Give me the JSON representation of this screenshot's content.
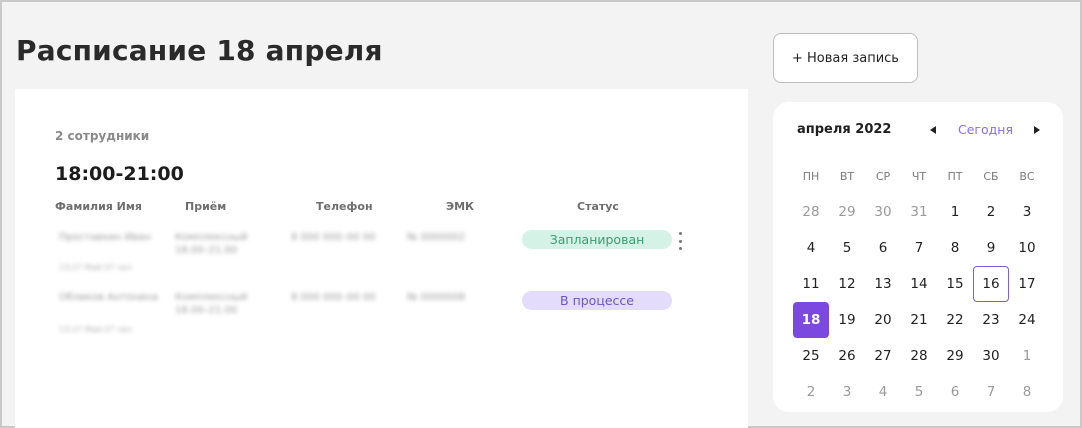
{
  "header": {
    "title": "Расписание 18 апреля",
    "new_button_label": "+ Новая запись"
  },
  "schedule": {
    "employees_count": "2 сотрудники",
    "time_range": "18:00-21:00",
    "columns": [
      "Фамилия Имя",
      "Приём",
      "Телефон",
      "ЭМК",
      "Статус"
    ],
    "rows": [
      {
        "name": "Проставкин Иван",
        "time": "13:27 Май 07 чел",
        "service": "Комплексный 18.00–21.00",
        "phone": "8 000 000–00 00",
        "emk": "№ 0000002",
        "status": "Запланирован",
        "status_bg": "#d4f3e6",
        "status_color": "#3d9b72"
      },
      {
        "name": "Обликов Антонина",
        "time": "13:27 Май 07 чел",
        "service": "Комплексный 18.00–21.00",
        "phone": "8 000 000–00 00",
        "emk": "№ 0000008",
        "status": "В процессе",
        "status_bg": "#e3dcfa",
        "status_color": "#6d55c4"
      }
    ]
  },
  "calendar": {
    "month_label": "апреля 2022",
    "today_label": "Сегодня",
    "weekdays": [
      "ПН",
      "ВТ",
      "СР",
      "ЧТ",
      "ПТ",
      "СБ",
      "ВС"
    ],
    "selected_day": 18,
    "today_day": 16,
    "accent_color": "#7b48e0",
    "weeks": [
      [
        {
          "d": "28",
          "o": true
        },
        {
          "d": "29",
          "o": true
        },
        {
          "d": "30",
          "o": true
        },
        {
          "d": "31",
          "o": true
        },
        {
          "d": "1"
        },
        {
          "d": "2"
        },
        {
          "d": "3"
        }
      ],
      [
        {
          "d": "4"
        },
        {
          "d": "5"
        },
        {
          "d": "6"
        },
        {
          "d": "7"
        },
        {
          "d": "8"
        },
        {
          "d": "9"
        },
        {
          "d": "10"
        }
      ],
      [
        {
          "d": "11"
        },
        {
          "d": "12"
        },
        {
          "d": "13"
        },
        {
          "d": "14"
        },
        {
          "d": "15"
        },
        {
          "d": "16"
        },
        {
          "d": "17"
        }
      ],
      [
        {
          "d": "18"
        },
        {
          "d": "19"
        },
        {
          "d": "20"
        },
        {
          "d": "21"
        },
        {
          "d": "22"
        },
        {
          "d": "23"
        },
        {
          "d": "24"
        }
      ],
      [
        {
          "d": "25"
        },
        {
          "d": "26"
        },
        {
          "d": "27"
        },
        {
          "d": "28"
        },
        {
          "d": "29"
        },
        {
          "d": "30"
        },
        {
          "d": "1",
          "o": true
        }
      ],
      [
        {
          "d": "2",
          "o": true
        },
        {
          "d": "3",
          "o": true
        },
        {
          "d": "4",
          "o": true
        },
        {
          "d": "5",
          "o": true
        },
        {
          "d": "6",
          "o": true
        },
        {
          "d": "7",
          "o": true
        },
        {
          "d": "8",
          "o": true
        }
      ]
    ]
  }
}
